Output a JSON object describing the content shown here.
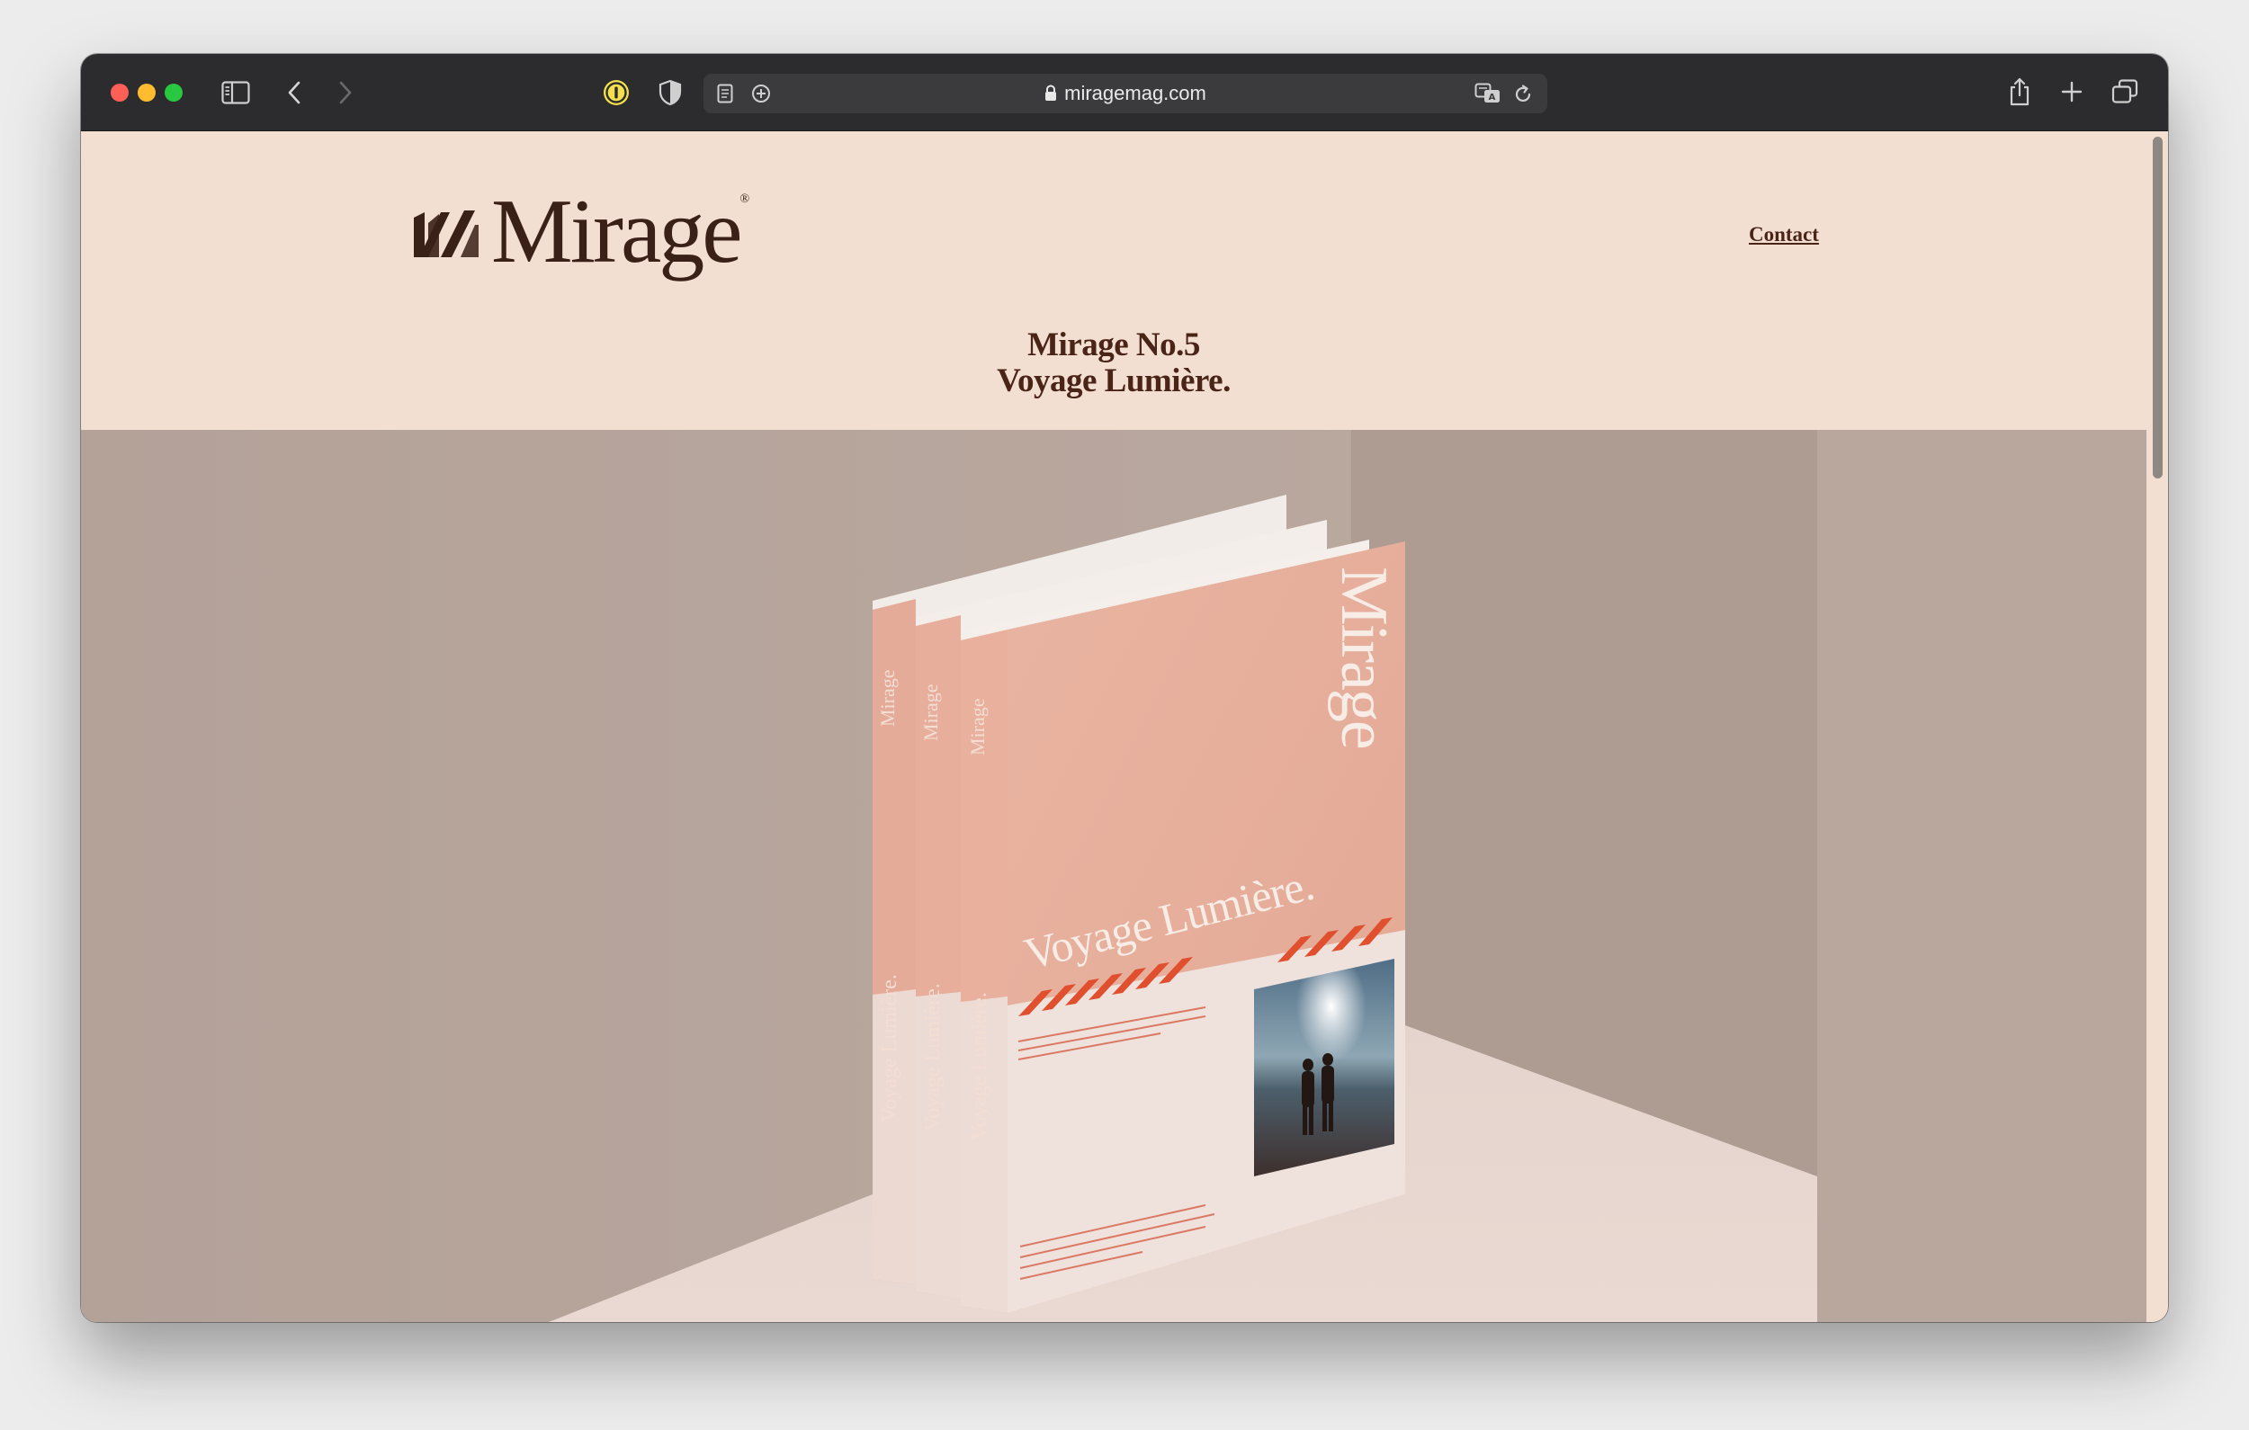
{
  "browser": {
    "url": "miragemag.com"
  },
  "site": {
    "logo_text": "Mirage",
    "logo_reg": "®",
    "nav_contact": "Contact",
    "headline_line1": "Mirage No.5",
    "headline_line2": "Voyage Lumière."
  },
  "hero_book": {
    "spine_title": "Mirage",
    "spine_subtitle": "Voyage Lumière.",
    "cover_title": "Mirage",
    "cover_subtitle": "Voyage Lumière."
  },
  "icons": [
    "sidebar-icon",
    "back-chevron-icon",
    "forward-chevron-icon",
    "password-manager-icon",
    "shield-icon",
    "reader-icon",
    "add-extension-icon",
    "lock-icon",
    "translate-icon",
    "reload-icon",
    "share-icon",
    "new-tab-plus-icon",
    "tab-overview-icon"
  ],
  "colors": {
    "page_bg": "#f3dfd2",
    "text_brown": "#4a2417",
    "wall": "#b5a39a",
    "book_pink": "#e8b29f",
    "accent_red": "#e0502e"
  }
}
